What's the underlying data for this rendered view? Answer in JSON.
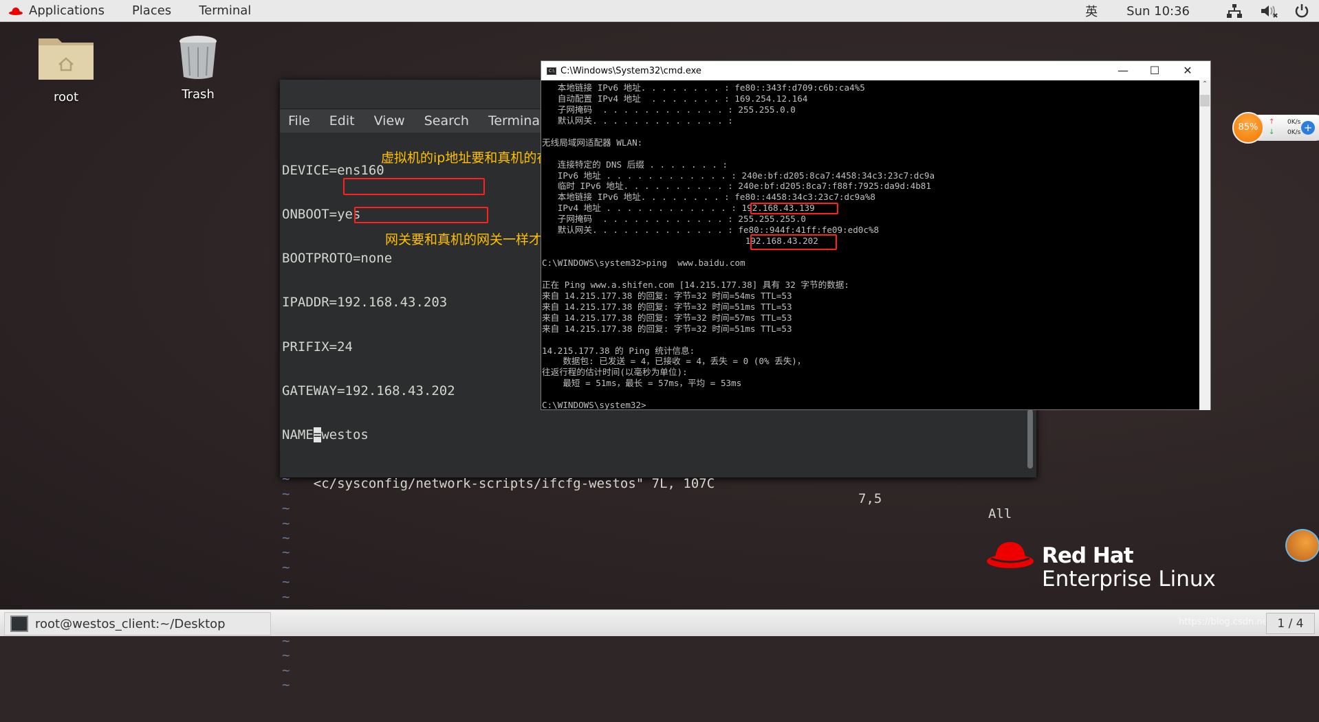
{
  "topbar": {
    "applications": "Applications",
    "places": "Places",
    "terminal": "Terminal",
    "input_method": "英",
    "clock": "Sun 10:36",
    "icons": [
      "network-icon",
      "volume-muted-icon",
      "power-icon"
    ]
  },
  "desktop": {
    "icons": [
      {
        "label": "root",
        "icon": "home-folder-icon"
      },
      {
        "label": "Trash",
        "icon": "trash-icon"
      }
    ]
  },
  "terminal": {
    "menu": [
      "File",
      "Edit",
      "View",
      "Search",
      "Terminal"
    ],
    "lines": [
      "DEVICE=ens160",
      "ONBOOT=yes",
      "BOOTPROTO=none",
      "IPADDR=192.168.43.203",
      "PRIFIX=24",
      "GATEWAY=192.168.43.202"
    ],
    "name_key": "NAME",
    "name_cursor": "=",
    "name_value": "westos",
    "tilde": "~",
    "status_file": "<c/sysconfig/network-scripts/ifcfg-westos\" 7L, 107C",
    "status_pos": "7,5",
    "status_all": "All"
  },
  "annotations": {
    "ip_note": "虚拟机的ip地址要和真机的在同一网段下",
    "gateway_note": "网关要和真机的网关一样才可以上网",
    "highlight_color": "#ff2020",
    "note_color": "#ffc000"
  },
  "cmd": {
    "title": "C:\\Windows\\System32\\cmd.exe",
    "lines": [
      "   本地链接 IPv6 地址. . . . . . . . : fe80::343f:d709:c6b:ca4%5",
      "   自动配置 IPv4 地址  . . . . . . . : 169.254.12.164",
      "   子网掩码  . . . . . . . . . . . . : 255.255.0.0",
      "   默认网关. . . . . . . . . . . . . :",
      "",
      "无线局域网适配器 WLAN:",
      "",
      "   连接特定的 DNS 后缀 . . . . . . . :",
      "   IPv6 地址 . . . . . . . . . . . . : 240e:bf:d205:8ca7:4458:34c3:23c7:dc9a",
      "   临时 IPv6 地址. . . . . . . . . . : 240e:bf:d205:8ca7:f88f:7925:da9d:4b81",
      "   本地链接 IPv6 地址. . . . . . . . : fe80::4458:34c3:23c7:dc9a%8",
      "   IPv4 地址 . . . . . . . . . . . . : 192.168.43.139",
      "   子网掩码  . . . . . . . . . . . . : 255.255.255.0",
      "   默认网关. . . . . . . . . . . . . : fe80::944f:41ff:fe09:ed0c%8",
      "                                       192.168.43.202",
      "",
      "C:\\WINDOWS\\system32>ping  www.baidu.com",
      "",
      "正在 Ping www.a.shifen.com [14.215.177.38] 具有 32 字节的数据:",
      "来自 14.215.177.38 的回复: 字节=32 时间=54ms TTL=53",
      "来自 14.215.177.38 的回复: 字节=32 时间=51ms TTL=53",
      "来自 14.215.177.38 的回复: 字节=32 时间=57ms TTL=53",
      "来自 14.215.177.38 的回复: 字节=32 时间=51ms TTL=53",
      "",
      "14.215.177.38 的 Ping 统计信息:",
      "    数据包: 已发送 = 4，已接收 = 4，丢失 = 0 (0% 丢失)，",
      "往返行程的估计时间(以毫秒为单位):",
      "    最短 = 51ms，最长 = 57ms，平均 = 53ms",
      "",
      "C:\\WINDOWS\\system32>"
    ]
  },
  "net_widget": {
    "percent": "85%",
    "upload": "0K/s",
    "download": "0K/s"
  },
  "brand": {
    "line1": "Red Hat",
    "line2": "Enterprise Linux",
    "color": "#ee0000"
  },
  "taskbar": {
    "task": "root@westos_client:~/Desktop",
    "pager": "1 / 4",
    "watermark": "https://blog.csdn.net/..."
  }
}
